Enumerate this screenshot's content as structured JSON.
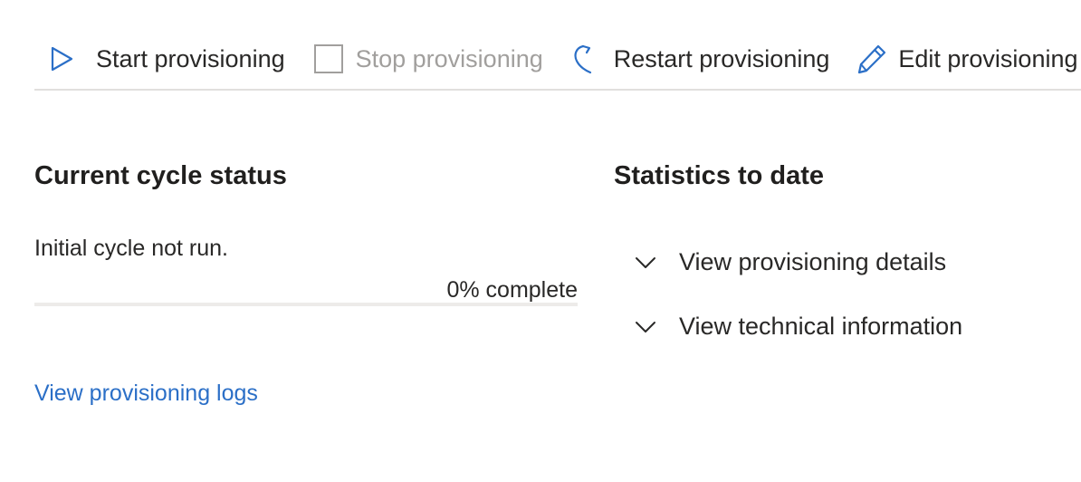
{
  "toolbar": {
    "start_label": "Start provisioning",
    "stop_label": "Stop provisioning",
    "restart_label": "Restart provisioning",
    "edit_label": "Edit provisioning",
    "accent_color": "#2b6fc7",
    "disabled_color": "#a19f9d",
    "icons": {
      "start": "play-icon",
      "stop": "stop-square-icon",
      "restart": "restart-icon",
      "edit": "pencil-icon"
    }
  },
  "cycle": {
    "title": "Current cycle status",
    "status_text": "Initial cycle not run.",
    "progress_label": "0% complete",
    "progress_fraction": 0,
    "logs_link": "View provisioning logs"
  },
  "statistics": {
    "title": "Statistics to date",
    "items": [
      {
        "label": "View provisioning details",
        "icon": "chevron-down-icon"
      },
      {
        "label": "View technical information",
        "icon": "chevron-down-icon"
      }
    ]
  }
}
